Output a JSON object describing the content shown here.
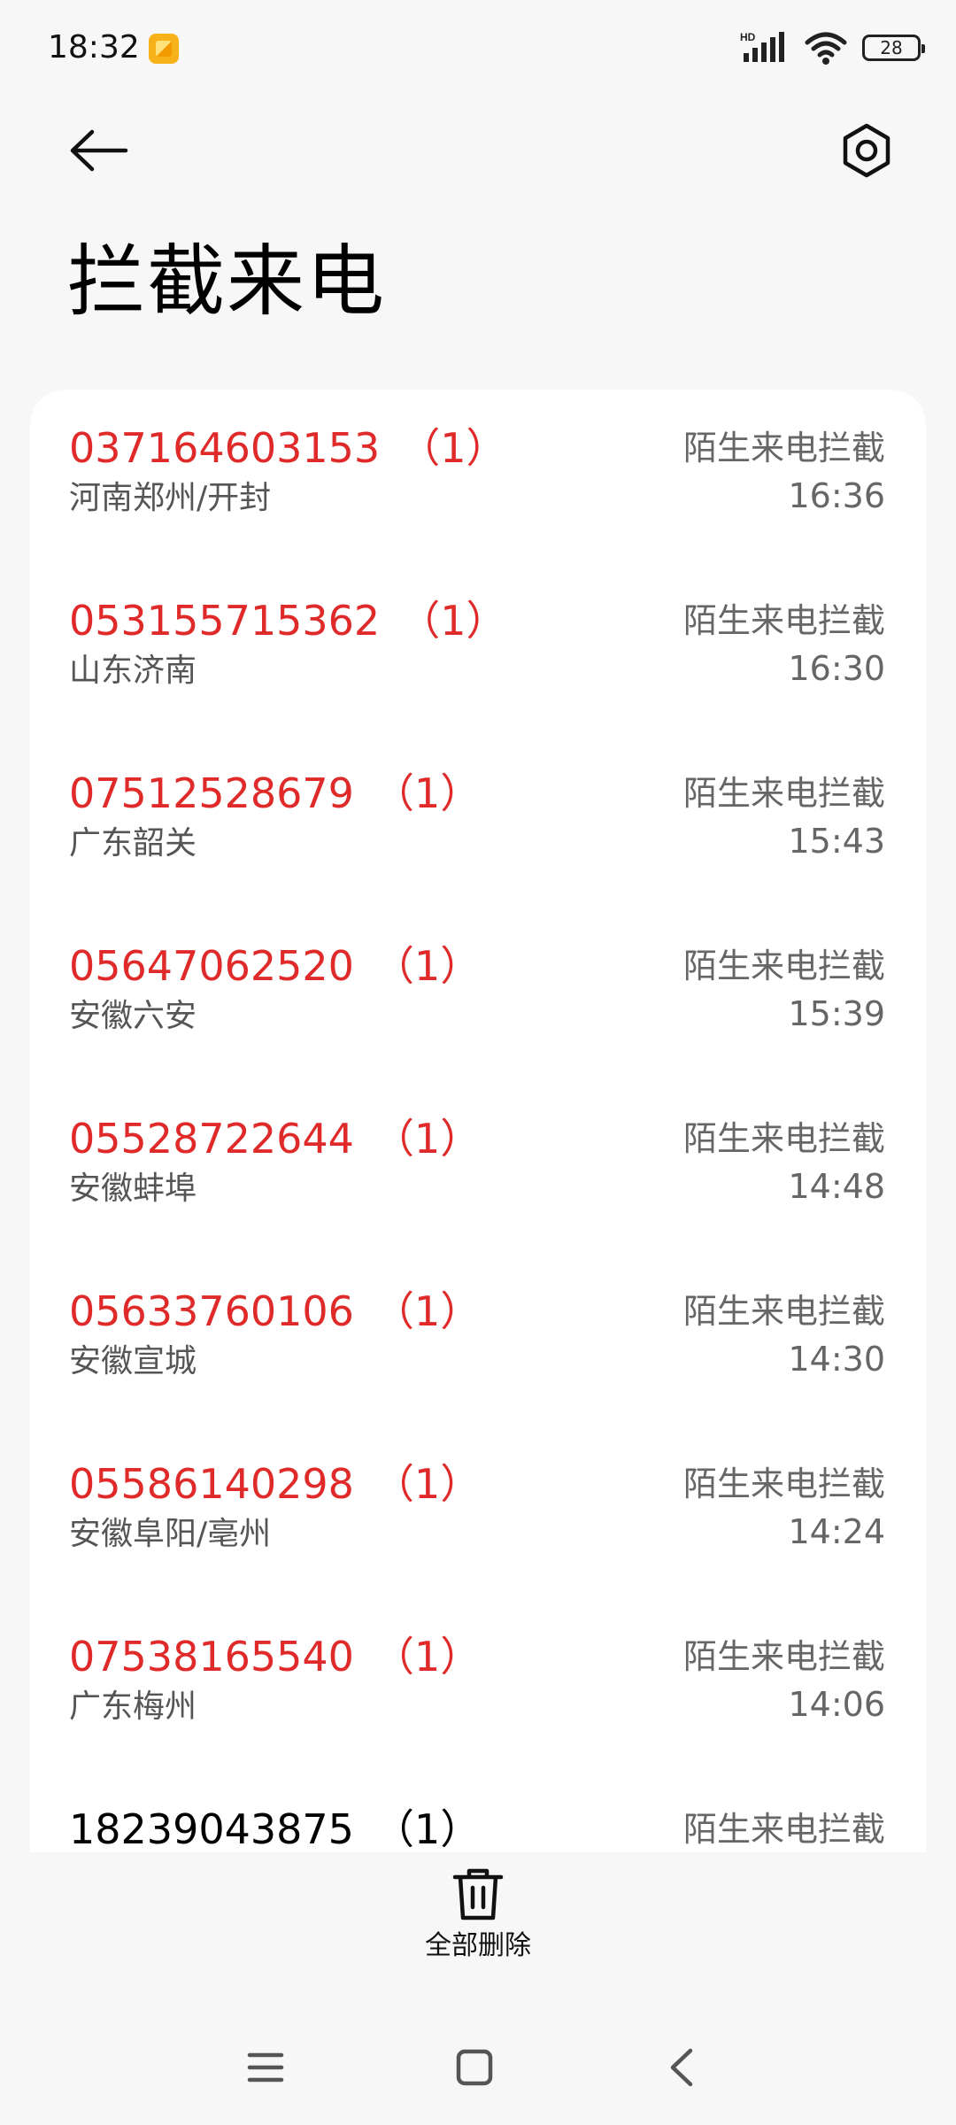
{
  "status_bar": {
    "time": "18:32",
    "network_label": "HD",
    "battery": "28"
  },
  "header": {
    "title": "拦截来电"
  },
  "calls": [
    {
      "number": "037164603153",
      "count": "（1）",
      "location": "河南郑州/开封",
      "type": "陌生来电拦截",
      "time": "16:36"
    },
    {
      "number": "053155715362",
      "count": "（1）",
      "location": "山东济南",
      "type": "陌生来电拦截",
      "time": "16:30"
    },
    {
      "number": "07512528679",
      "count": "（1）",
      "location": "广东韶关",
      "type": "陌生来电拦截",
      "time": "15:43"
    },
    {
      "number": "05647062520",
      "count": "（1）",
      "location": "安徽六安",
      "type": "陌生来电拦截",
      "time": "15:39"
    },
    {
      "number": "05528722644",
      "count": "（1）",
      "location": "安徽蚌埠",
      "type": "陌生来电拦截",
      "time": "14:48"
    },
    {
      "number": "05633760106",
      "count": "（1）",
      "location": "安徽宣城",
      "type": "陌生来电拦截",
      "time": "14:30"
    },
    {
      "number": "05586140298",
      "count": "（1）",
      "location": "安徽阜阳/亳州",
      "type": "陌生来电拦截",
      "time": "14:24"
    },
    {
      "number": "07538165540",
      "count": "（1）",
      "location": "广东梅州",
      "type": "陌生来电拦截",
      "time": "14:06"
    },
    {
      "number": "18239043875",
      "count": "（1）",
      "location": "",
      "type": "陌生来电拦截",
      "time": ""
    }
  ],
  "actions": {
    "delete_all_label": "全部删除"
  },
  "colors": {
    "blocked_number": "#e02a2a",
    "background": "#f7f7f7",
    "card": "#ffffff"
  },
  "icons": {
    "back": "arrow-left-icon",
    "settings": "settings-hexagon-icon",
    "delete": "trash-icon",
    "nav_menu": "menu-icon",
    "nav_home": "square-icon",
    "nav_back": "chevron-left-icon"
  }
}
